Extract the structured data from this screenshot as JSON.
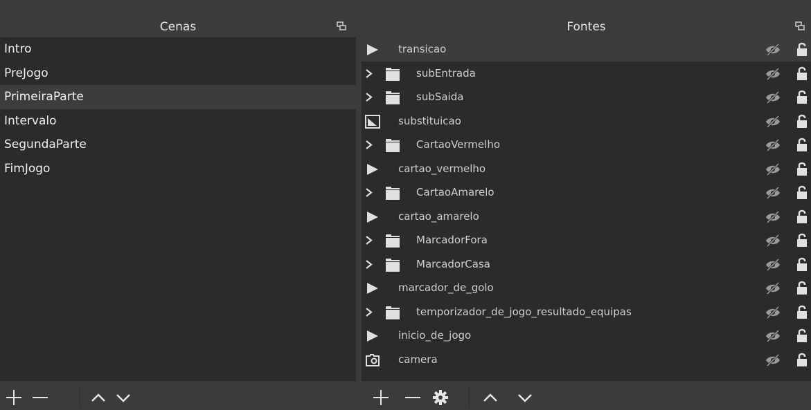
{
  "scenes": {
    "title": "Cenas",
    "items": [
      {
        "label": "Intro",
        "selected": false
      },
      {
        "label": "PreJogo",
        "selected": false
      },
      {
        "label": "PrimeiraParte",
        "selected": true
      },
      {
        "label": "Intervalo",
        "selected": false
      },
      {
        "label": "SegundaParte",
        "selected": false
      },
      {
        "label": "FimJogo",
        "selected": false
      }
    ],
    "toolbar": [
      "add-icon",
      "remove-icon",
      "move-up-icon",
      "move-down-icon"
    ]
  },
  "sources": {
    "title": "Fontes",
    "items": [
      {
        "label": "transicao",
        "type": "media",
        "expandable": false,
        "selected": true
      },
      {
        "label": "subEntrada",
        "type": "group",
        "expandable": true,
        "selected": false
      },
      {
        "label": "subSaida",
        "type": "group",
        "expandable": true,
        "selected": false
      },
      {
        "label": "substituicao",
        "type": "image",
        "expandable": false,
        "selected": false
      },
      {
        "label": "CartaoVermelho",
        "type": "group",
        "expandable": true,
        "selected": false
      },
      {
        "label": "cartao_vermelho",
        "type": "media",
        "expandable": false,
        "selected": false
      },
      {
        "label": "CartaoAmarelo",
        "type": "group",
        "expandable": true,
        "selected": false
      },
      {
        "label": "cartao_amarelo",
        "type": "media",
        "expandable": false,
        "selected": false
      },
      {
        "label": "MarcadorFora",
        "type": "group",
        "expandable": true,
        "selected": false
      },
      {
        "label": "MarcadorCasa",
        "type": "group",
        "expandable": true,
        "selected": false
      },
      {
        "label": "marcador_de_golo",
        "type": "media",
        "expandable": false,
        "selected": false
      },
      {
        "label": "temporizador_de_jogo_resultado_equipas",
        "type": "group",
        "expandable": true,
        "selected": false
      },
      {
        "label": "inicio_de_jogo",
        "type": "media",
        "expandable": false,
        "selected": false
      },
      {
        "label": "camera",
        "type": "camera",
        "expandable": false,
        "selected": false
      }
    ],
    "row_icons": [
      "visibility-hidden-icon",
      "lock-unlocked-icon"
    ],
    "toolbar": [
      "add-icon",
      "remove-icon",
      "properties-gear-icon",
      "move-up-icon",
      "move-down-icon"
    ]
  },
  "colors": {
    "panel_bg": "#2b2b2b",
    "header_bg": "#3b3b3b",
    "selected_row": "#3c3c3c",
    "text": "#f0f0f0"
  }
}
